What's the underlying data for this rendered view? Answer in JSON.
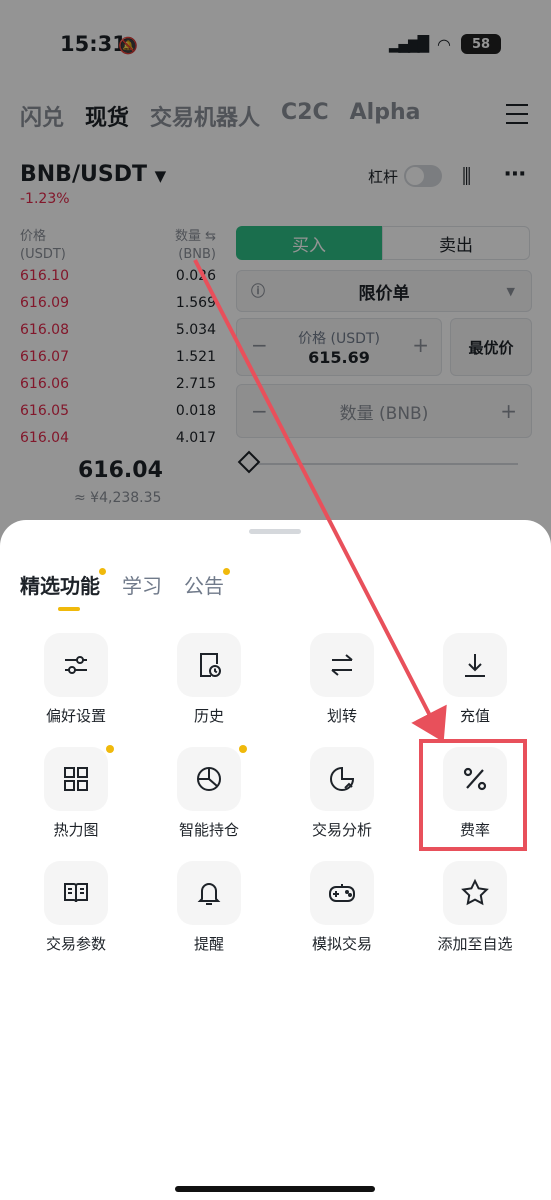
{
  "status_bar": {
    "time": "15:31",
    "battery": "58"
  },
  "top_tabs": [
    {
      "label": "闪兑",
      "active": false
    },
    {
      "label": "现货",
      "active": true
    },
    {
      "label": "交易机器人",
      "active": false
    },
    {
      "label": "C2C",
      "active": false
    },
    {
      "label": "Alpha",
      "active": false
    }
  ],
  "pair": {
    "name": "BNB/USDT",
    "change": "-1.23%",
    "leverage_label": "杠杆"
  },
  "order_book": {
    "price_header": "价格",
    "price_unit": "(USDT)",
    "qty_header": "数量 ⇆",
    "qty_unit": "(BNB)",
    "rows": [
      {
        "price": "616.10",
        "qty": "0.026"
      },
      {
        "price": "616.09",
        "qty": "1.569"
      },
      {
        "price": "616.08",
        "qty": "5.034"
      },
      {
        "price": "616.07",
        "qty": "1.521"
      },
      {
        "price": "616.06",
        "qty": "2.715"
      },
      {
        "price": "616.05",
        "qty": "0.018"
      },
      {
        "price": "616.04",
        "qty": "4.017"
      }
    ],
    "last_price": "616.04",
    "last_price_cny": "≈ ¥4,238.35"
  },
  "order_form": {
    "buy": "买入",
    "sell": "卖出",
    "order_type": "限价单",
    "price_label": "价格 (USDT)",
    "price_value": "615.69",
    "best_price": "最优价",
    "qty_placeholder": "数量 (BNB)"
  },
  "sheet": {
    "tabs": [
      {
        "label": "精选功能",
        "active": true,
        "dot": true
      },
      {
        "label": "学习",
        "active": false,
        "dot": false
      },
      {
        "label": "公告",
        "active": false,
        "dot": true
      }
    ],
    "tiles": [
      {
        "label": "偏好设置",
        "icon": "sliders-icon",
        "dot": false
      },
      {
        "label": "历史",
        "icon": "history-icon",
        "dot": false
      },
      {
        "label": "划转",
        "icon": "transfer-icon",
        "dot": false
      },
      {
        "label": "充值",
        "icon": "deposit-icon",
        "dot": false
      },
      {
        "label": "热力图",
        "icon": "heatmap-icon",
        "dot": true
      },
      {
        "label": "智能持仓",
        "icon": "pie-chart-icon",
        "dot": true
      },
      {
        "label": "交易分析",
        "icon": "analysis-icon",
        "dot": false
      },
      {
        "label": "费率",
        "icon": "percent-icon",
        "dot": false
      },
      {
        "label": "交易参数",
        "icon": "book-icon",
        "dot": false
      },
      {
        "label": "提醒",
        "icon": "bell-icon",
        "dot": false
      },
      {
        "label": "模拟交易",
        "icon": "gamepad-icon",
        "dot": false
      },
      {
        "label": "添加至自选",
        "icon": "star-icon",
        "dot": false
      }
    ]
  },
  "colors": {
    "accent": "#f0b90b",
    "buy": "#2ebd85",
    "sell": "#e0294a",
    "annotation": "#e8505b"
  }
}
